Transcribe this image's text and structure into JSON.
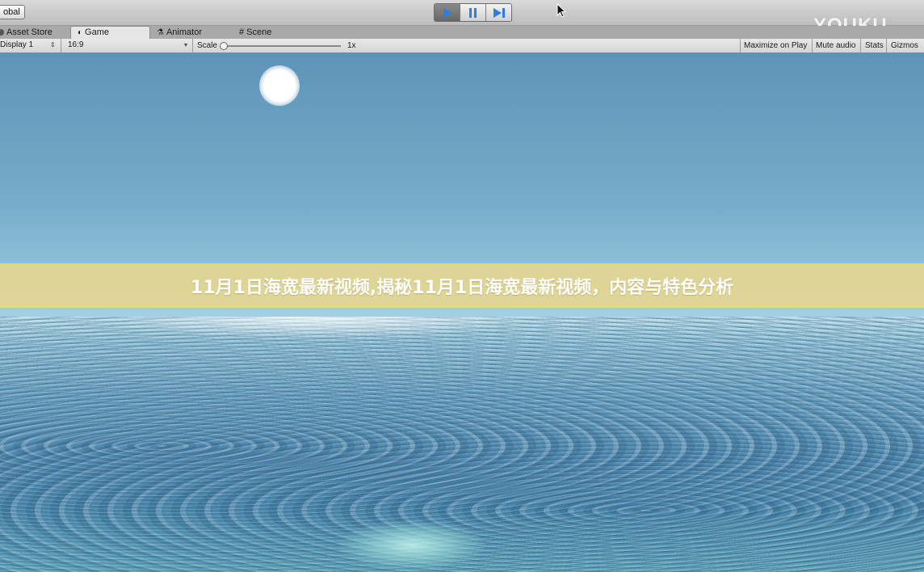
{
  "toolbar": {
    "global_label": "obal",
    "play_icon": "play-icon",
    "pause_icon": "pause-icon",
    "step_icon": "step-icon",
    "watermark": "YOUKU"
  },
  "tabs": [
    {
      "label": "Asset Store",
      "icon": "asset-store-icon"
    },
    {
      "label": "Game",
      "icon": "game-icon",
      "active": true
    },
    {
      "label": "Animator",
      "icon": "animator-icon"
    },
    {
      "label": "Scene",
      "icon": "scene-icon"
    }
  ],
  "game_bar": {
    "display": "Display 1",
    "aspect": "16:9",
    "scale_label": "Scale",
    "scale_value": "1x",
    "maximize": "Maximize on Play",
    "mute": "Mute audio",
    "stats": "Stats",
    "gizmos": "Gizmos"
  },
  "banner": {
    "title": "11月1日海宽最新视频,揭秘11月1日海宽最新视频，内容与特色分析"
  },
  "colors": {
    "sky_top": "#5d93b6",
    "horizon": "#cde8ef",
    "sea": "#4f86ab",
    "banner": "#e8d68c"
  }
}
